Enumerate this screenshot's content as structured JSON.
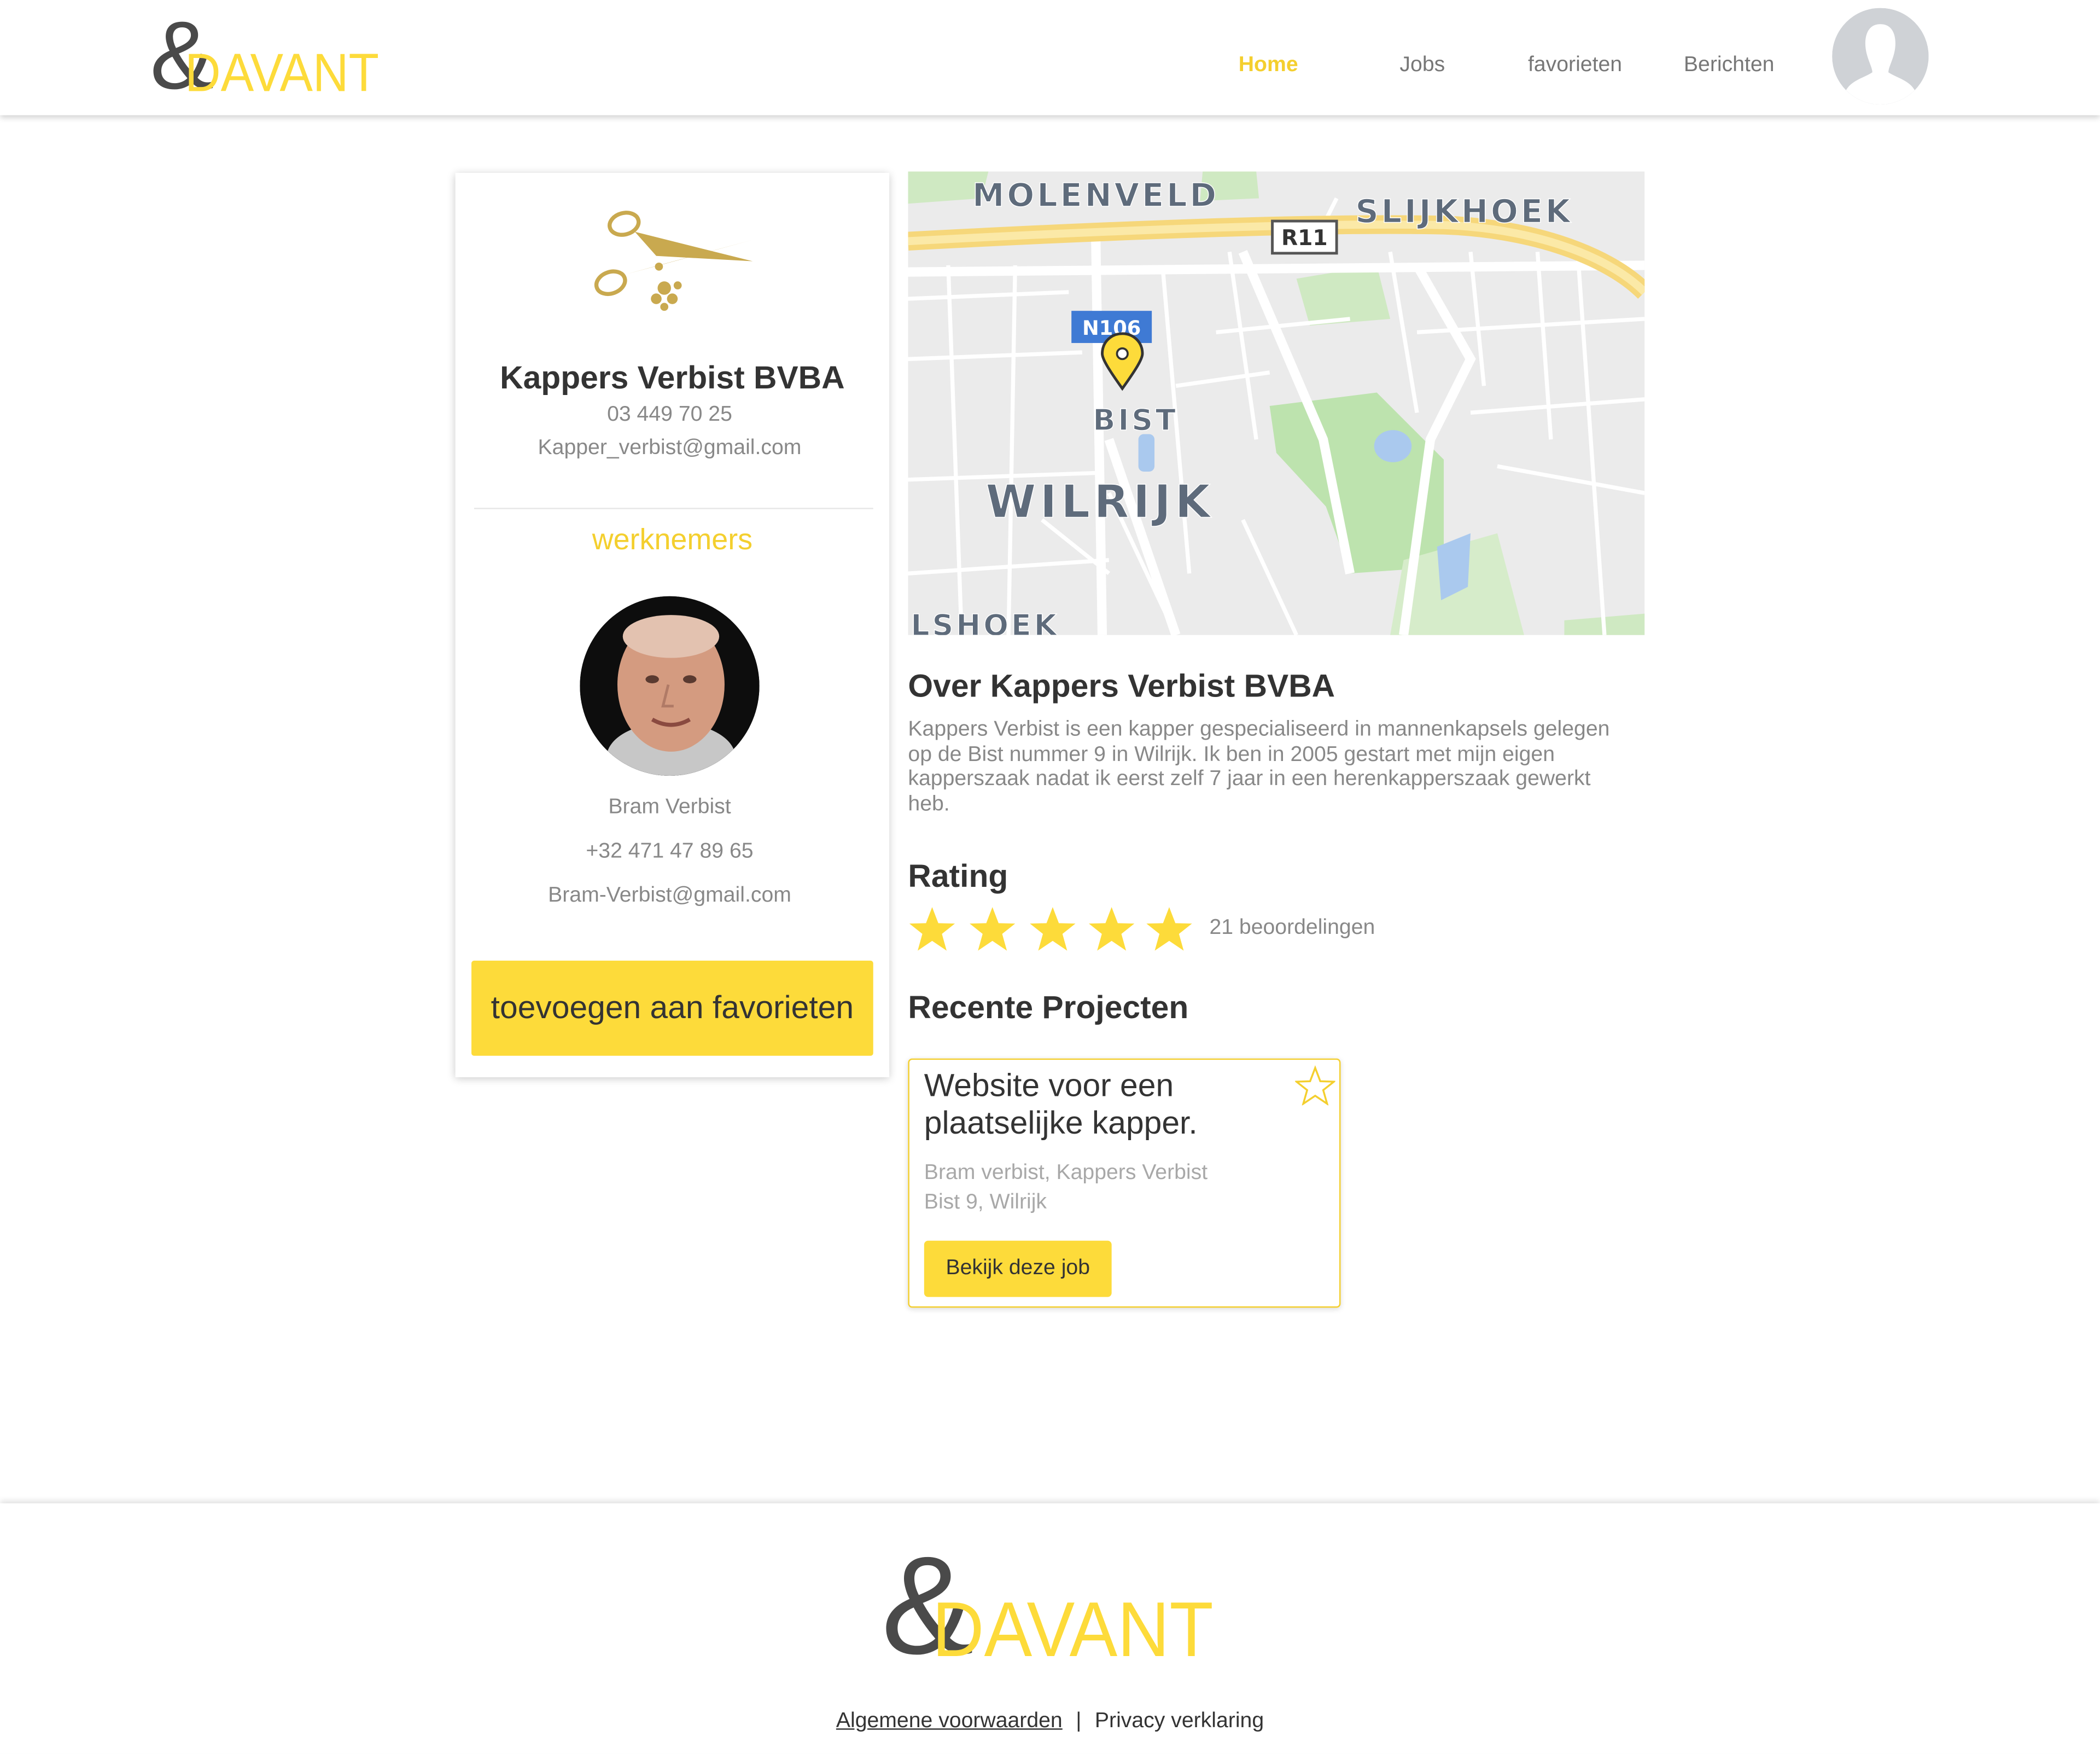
{
  "brand": {
    "logo_text": "DAVANT",
    "logo_symbol": "&",
    "colors": {
      "primary_yellow": "#fddb3a",
      "dark_gray": "#4a4a4a",
      "text_gray": "#888888"
    }
  },
  "nav": {
    "items": [
      {
        "label": "Home",
        "active": true
      },
      {
        "label": "Jobs",
        "active": false
      },
      {
        "label": "favorieten",
        "active": false
      },
      {
        "label": "Berichten",
        "active": false
      }
    ],
    "avatar_icon": "user-silhouette-icon"
  },
  "company": {
    "logo_icon": "scissors-icon",
    "name": "Kappers Verbist BVBA",
    "phone": "03 449 70 25",
    "email": "Kapper_verbist@gmail.com"
  },
  "employees": {
    "heading": "werknemers",
    "items": [
      {
        "name": "Bram Verbist",
        "phone": "+32 471 47 89 65",
        "email": "Bram-Verbist@gmail.com"
      }
    ]
  },
  "favorite_button": "toevoegen aan favorieten",
  "map": {
    "labels": [
      "MOLENVELD",
      "SLIJKHOEK",
      "R11",
      "N106",
      "BIST",
      "WILRIJK",
      "LSHOEK"
    ],
    "marker_icon": "map-pin-icon"
  },
  "about": {
    "title": "Over Kappers Verbist BVBA",
    "text": "Kappers Verbist is een kapper gespecialiseerd in mannenkapsels gelegen op de Bist nummer 9 in Wilrijk. Ik ben in 2005 gestart met mijn eigen kapperszaak nadat ik eerst zelf 7 jaar in een herenkapperszaak gewerkt heb."
  },
  "rating": {
    "title": "Rating",
    "stars": 5,
    "max_stars": 5,
    "count_text": "21 beoordelingen"
  },
  "projects": {
    "title": "Recente Projecten",
    "items": [
      {
        "title": "Website voor een plaatselijke kapper.",
        "meta1": "Bram verbist, Kappers Verbist",
        "meta2": "Bist 9, Wilrijk",
        "button": "Bekijk deze job",
        "favorite_icon": "star-outline-icon"
      }
    ]
  },
  "footer": {
    "links": [
      "Algemene voorwaarden",
      "Privacy verklaring"
    ],
    "separator": "|"
  }
}
